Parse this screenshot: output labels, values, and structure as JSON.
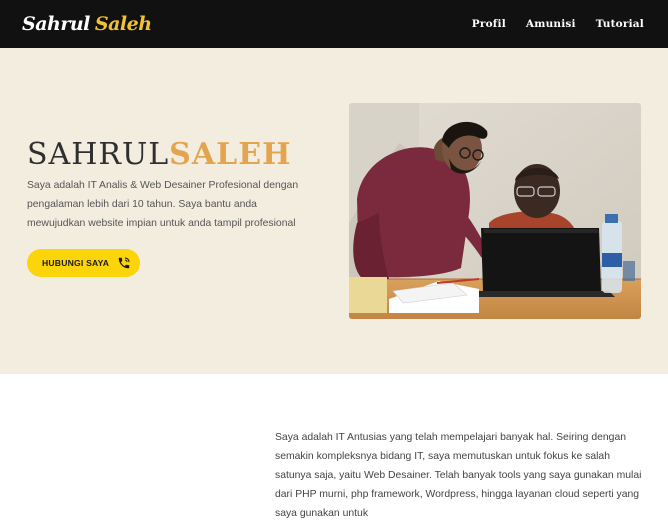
{
  "brand": {
    "first": "Sahrul",
    "last": "Saleh"
  },
  "nav": {
    "items": [
      "Profil",
      "Amunisi",
      "Tutorial"
    ]
  },
  "hero": {
    "title_first": "SAHRUL",
    "title_last": "SALEH",
    "description": "Saya adalah IT Analis & Web Desainer Profesional dengan pengalaman lebih dari 10 tahun. Saya  bantu anda mewujudkan website impian untuk anda tampil profesional",
    "cta_label": "HUBUNGI SAYA",
    "cta_icon": "phone-icon"
  },
  "about": {
    "text": "Saya adalah IT Antusias yang telah mempelajari banyak hal. Seiring dengan semakin kompleksnya bidang IT, saya memutuskan untuk fokus ke salah satunya  saja, yaitu Web Desainer. Telah banyak tools yang saya gunakan mulai dari PHP murni, php framework, Wordpress, hingga layanan cloud seperti yang saya gunakan untuk"
  },
  "colors": {
    "nav_bg": "#111111",
    "accent_yellow": "#f2c230",
    "title_accent": "#e3a44f",
    "hero_bg": "#f3ede0",
    "cta_bg": "#fbd40a"
  }
}
